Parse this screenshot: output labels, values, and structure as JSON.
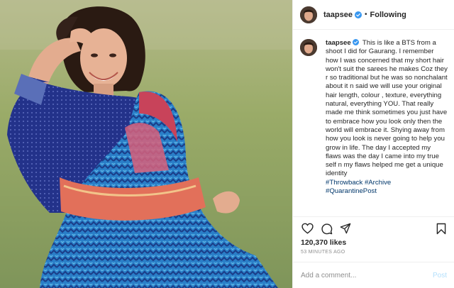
{
  "post": {
    "username": "taapsee",
    "follow_status": "Following",
    "separator": "•",
    "caption_text": "This is like a BTS from a shoot I did for Gaurang. I remember how I was concerned that my short hair won't suit the sarees he makes Coz they r so traditional but he was so nonchalant about it n said we will use your original hair length, colour , texture, everything natural, everything YOU. That really made me think sometimes you just have to embrace how you look only then the world will embrace it. Shying away from how you look is never going to help you grow in life. The day I accepted my flaws was the day I came into my true self n my flaws helped me get a unique identity",
    "hashtags": [
      "#Throwback",
      "#Archive",
      "#QuarantinePost"
    ],
    "likes": "120,370 likes",
    "timestamp": "53 MINUTES AGO"
  },
  "comment": {
    "placeholder": "Add a comment...",
    "post_label": "Post"
  },
  "icons": {
    "verified": "verified-badge-icon",
    "like": "heart-icon",
    "comment": "comment-icon",
    "share": "share-icon",
    "save": "bookmark-icon"
  },
  "colors": {
    "verified_blue": "#3897f0",
    "hashtag_blue": "#00376b",
    "post_disabled": "#b2dffc"
  }
}
